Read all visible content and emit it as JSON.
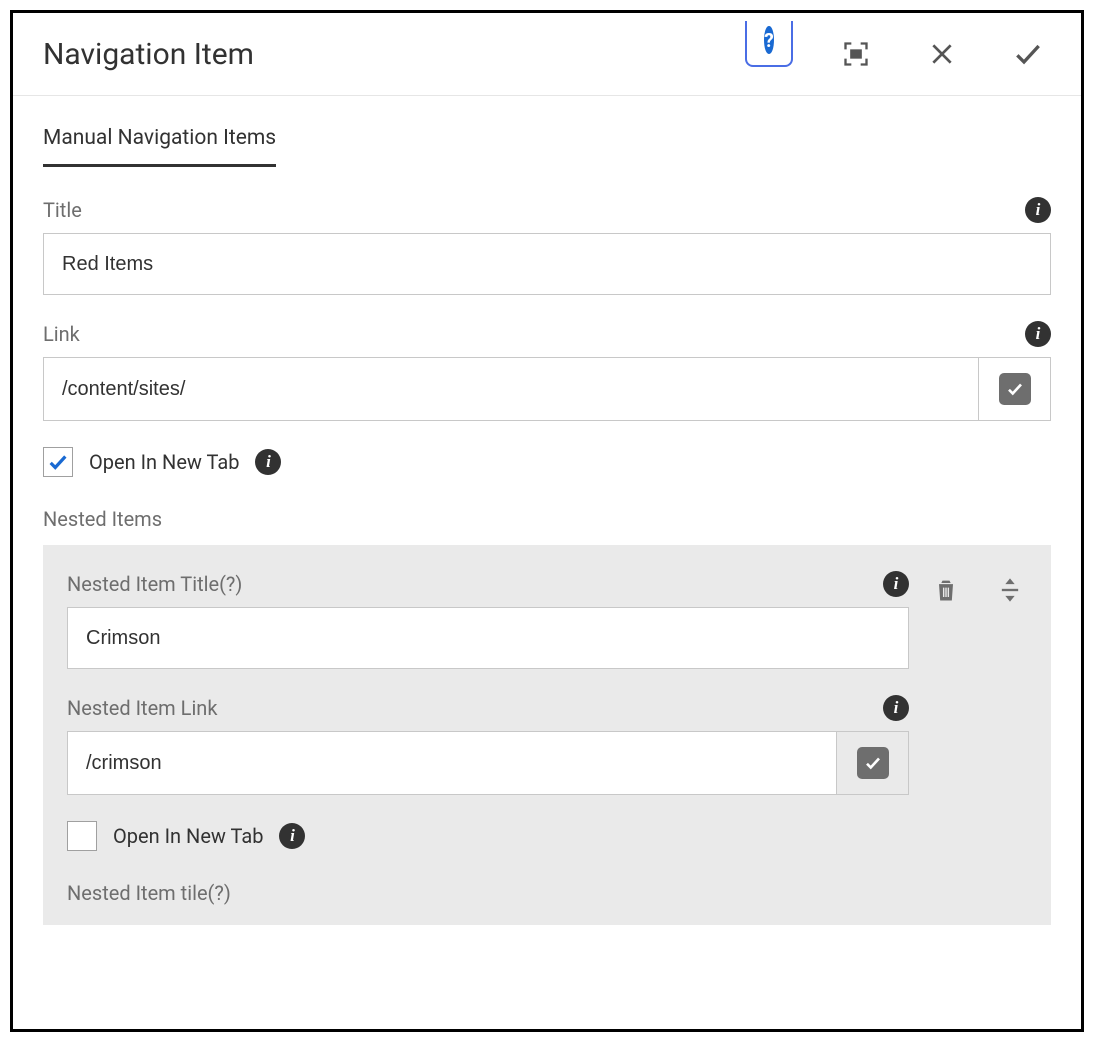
{
  "dialog": {
    "title": "Navigation Item"
  },
  "tabs": {
    "manual": "Manual Navigation Items"
  },
  "fields": {
    "title_label": "Title",
    "title_value": "Red Items",
    "link_label": "Link",
    "link_value": "/content/sites/",
    "open_new_tab_label": "Open In New Tab",
    "open_new_tab_checked": true,
    "nested_items_label": "Nested Items"
  },
  "nested": {
    "item1": {
      "title_label": "Nested Item Title(?)",
      "title_value": "Crimson",
      "link_label": "Nested Item Link",
      "link_value": "/crimson",
      "open_new_tab_label": "Open In New Tab",
      "open_new_tab_checked": false
    },
    "item2": {
      "title_label": "Nested Item tile(?)"
    }
  }
}
